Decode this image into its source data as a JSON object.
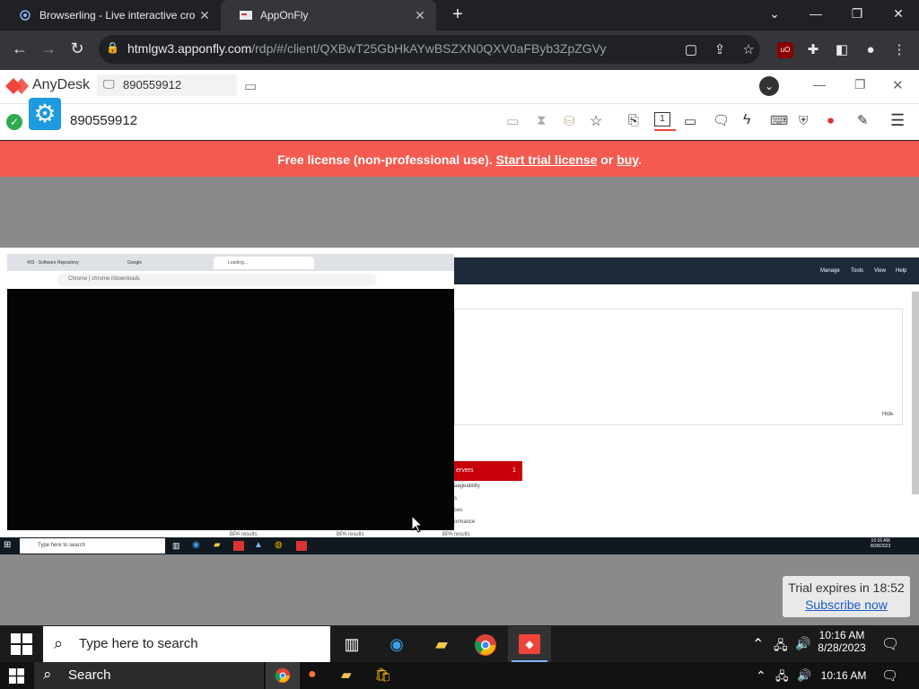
{
  "browser": {
    "tabs": [
      {
        "title": "Browserling - Live interactive cro",
        "active": false
      },
      {
        "title": "AppOnFly",
        "active": true
      }
    ],
    "url_host": "htmlgw3.apponfly.com",
    "url_path": "/rdp/#/client/QXBwT25GbHkAYwBSZXN0QXV0aFByb3ZpZGVy"
  },
  "anydesk": {
    "app_name": "AnyDesk",
    "address": "890559912",
    "session_id": "890559912",
    "banner": {
      "prefix": "Free license (non-professional use).",
      "trial_link": "Start trial license",
      "middle": "or",
      "buy_link": "buy",
      "suffix": "."
    }
  },
  "remote": {
    "inner_tabs": [
      "403 - Software Repository",
      "Google",
      "Loading..."
    ],
    "inner_url": "Chrome | chrome://downloads",
    "menu": [
      "Manage",
      "Tools",
      "View",
      "Help"
    ],
    "hide": "Hide",
    "servers_label": "ervers",
    "servers_count": "1",
    "list_items": [
      "aageability",
      "s",
      "ces",
      "ormance"
    ],
    "bpa": [
      "BPA results",
      "BPA results",
      "BPA results"
    ],
    "taskbar_search": "Type here to search",
    "time": "10:16 AM",
    "date": "8/28/2023"
  },
  "trial": {
    "text": "Trial expires in 18:52",
    "link": "Subscribe now"
  },
  "taskbar1": {
    "search": "Type here to search",
    "time": "10:16 AM",
    "date": "8/28/2023"
  },
  "taskbar2": {
    "search": "Search",
    "time": "10:16 AM"
  },
  "colors": {
    "banner": "#f45a4f",
    "chrome_dark": "#202124",
    "servers_red": "#c8000a"
  }
}
